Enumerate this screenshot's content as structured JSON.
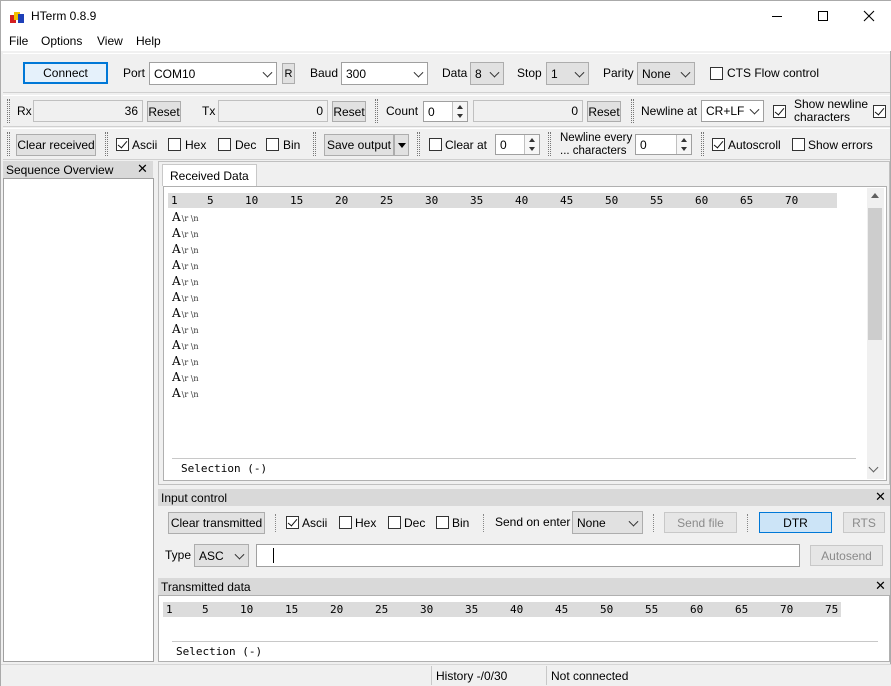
{
  "window": {
    "title": "HTerm 0.8.9",
    "menu": [
      "File",
      "Options",
      "View",
      "Help"
    ]
  },
  "connection": {
    "connect_label": "Connect",
    "port_label": "Port",
    "port_value": "COM10",
    "r_label": "R",
    "baud_label": "Baud",
    "baud_value": "300",
    "data_label": "Data",
    "data_value": "8",
    "stop_label": "Stop",
    "stop_value": "1",
    "parity_label": "Parity",
    "parity_value": "None",
    "cts_label": "CTS Flow control",
    "cts_checked": false
  },
  "counters": {
    "rx_label": "Rx",
    "rx_value": "36",
    "rx_reset": "Reset",
    "tx_label": "Tx",
    "tx_value": "0",
    "tx_reset": "Reset",
    "count_label": "Count",
    "count_spin": "0",
    "count_value": "0",
    "count_reset": "Reset",
    "newline_label": "Newline at",
    "newline_value": "CR+LF",
    "show_newline_label_1": "Show newline",
    "show_newline_label_2": "characters",
    "show_newline_checked": true
  },
  "receive_options": {
    "clear_received": "Clear received",
    "ascii": "Ascii",
    "hex": "Hex",
    "dec": "Dec",
    "bin": "Bin",
    "save_output": "Save output",
    "clear_at_label": "Clear at",
    "clear_at_value": "0",
    "newline_every_1": "Newline every",
    "newline_every_2": "... characters",
    "newline_every_value": "0",
    "autoscroll": "Autoscroll",
    "show_errors": "Show errors"
  },
  "sequence_overview": {
    "title": "Sequence Overview"
  },
  "received": {
    "tab": "Received Data",
    "ruler": [
      "1",
      "5",
      "10",
      "15",
      "20",
      "25",
      "30",
      "35",
      "40",
      "45",
      "50",
      "55",
      "60",
      "65",
      "70"
    ],
    "lines": [
      {
        "char": "A",
        "suffix": "\\r \\n"
      },
      {
        "char": "A",
        "suffix": "\\r \\n"
      },
      {
        "char": "A",
        "suffix": "\\r \\n"
      },
      {
        "char": "A",
        "suffix": "\\r \\n"
      },
      {
        "char": "A",
        "suffix": "\\r \\n"
      },
      {
        "char": "A",
        "suffix": "\\r \\n"
      },
      {
        "char": "A",
        "suffix": "\\r \\n"
      },
      {
        "char": "A",
        "suffix": "\\r \\n"
      },
      {
        "char": "A",
        "suffix": "\\r \\n"
      },
      {
        "char": "A",
        "suffix": "\\r \\n"
      },
      {
        "char": "A",
        "suffix": "\\r \\n"
      },
      {
        "char": "A",
        "suffix": "\\r \\n"
      }
    ],
    "selection": "Selection (-)"
  },
  "input_control": {
    "title": "Input control",
    "clear_transmitted": "Clear transmitted",
    "ascii": "Ascii",
    "hex": "Hex",
    "dec": "Dec",
    "bin": "Bin",
    "send_on_enter_label": "Send on enter",
    "send_on_enter_value": "None",
    "send_file": "Send file",
    "dtr": "DTR",
    "rts": "RTS",
    "type_label": "Type",
    "type_value": "ASC",
    "input_value": "",
    "autosend": "Autosend"
  },
  "transmitted": {
    "title": "Transmitted data",
    "ruler": [
      "1",
      "5",
      "10",
      "15",
      "20",
      "25",
      "30",
      "35",
      "40",
      "45",
      "50",
      "55",
      "60",
      "65",
      "70",
      "75"
    ],
    "selection": "Selection (-)"
  },
  "status": {
    "history": "History -/0/30",
    "connection": "Not connected"
  }
}
